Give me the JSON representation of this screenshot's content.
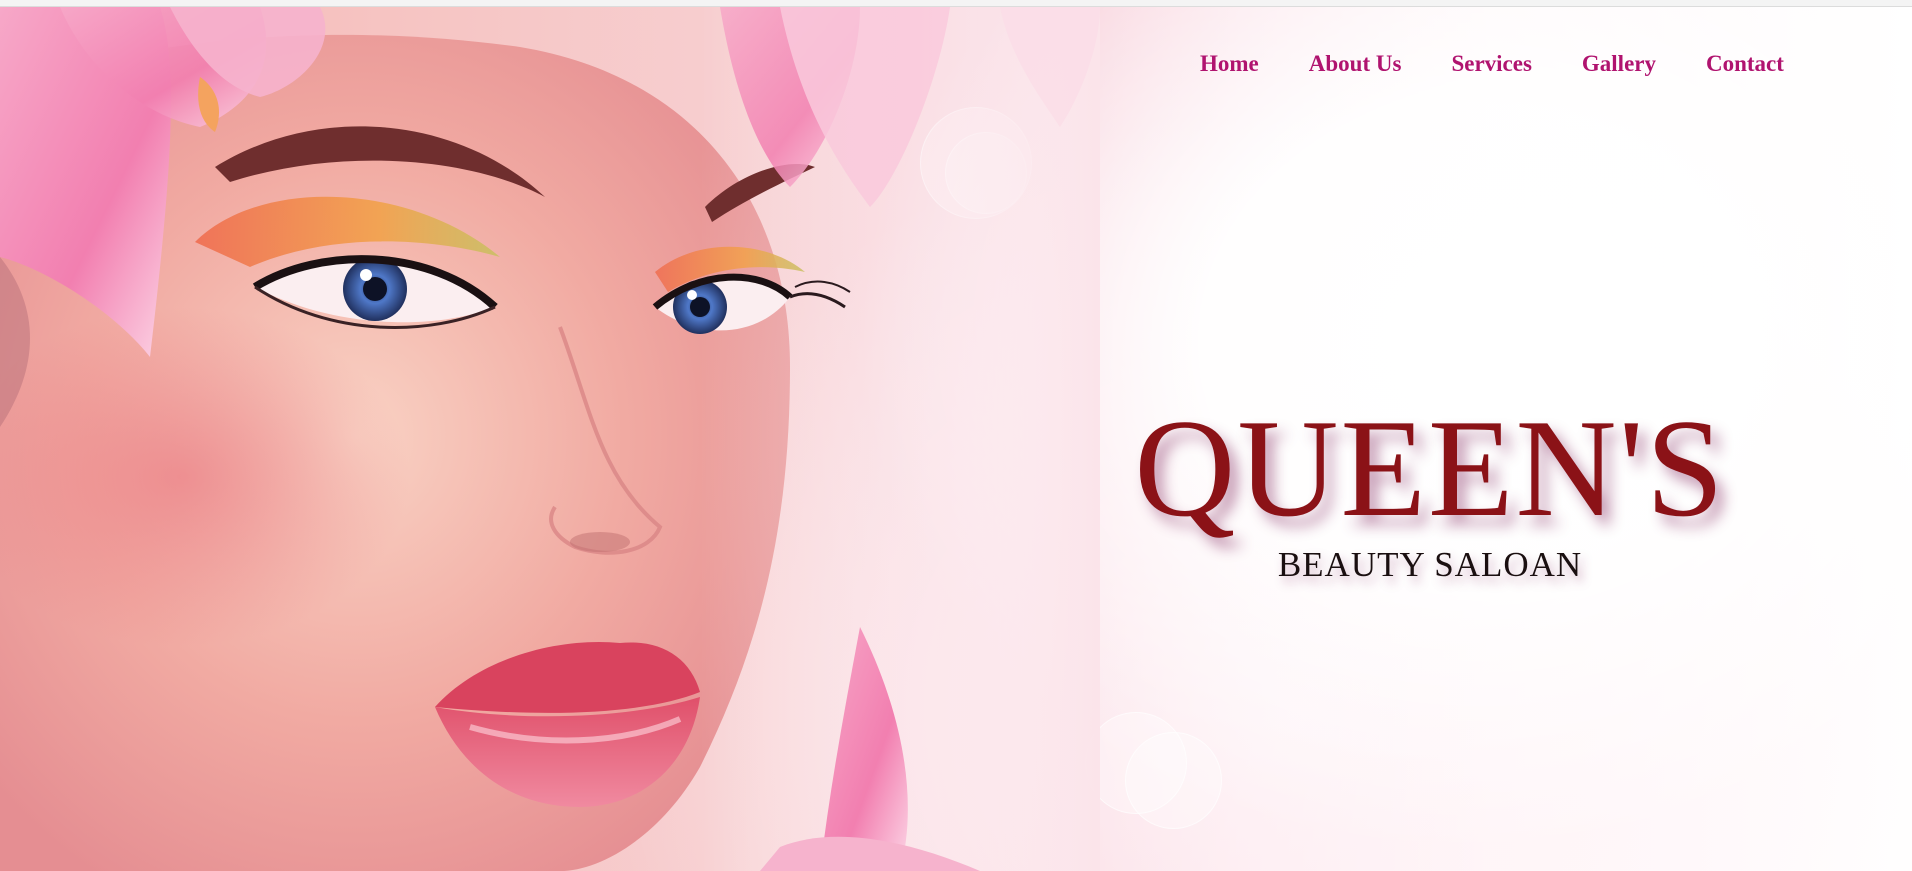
{
  "nav": {
    "items": [
      {
        "label": "Home"
      },
      {
        "label": "About Us"
      },
      {
        "label": "Services"
      },
      {
        "label": "Gallery"
      },
      {
        "label": "Contact"
      }
    ]
  },
  "hero": {
    "title": "QUEEN'S",
    "subtitle": "BEAUTY SALOAN"
  },
  "colors": {
    "nav_link": "#b0136f",
    "title": "#8b1217",
    "subtitle": "#1a0f10"
  }
}
